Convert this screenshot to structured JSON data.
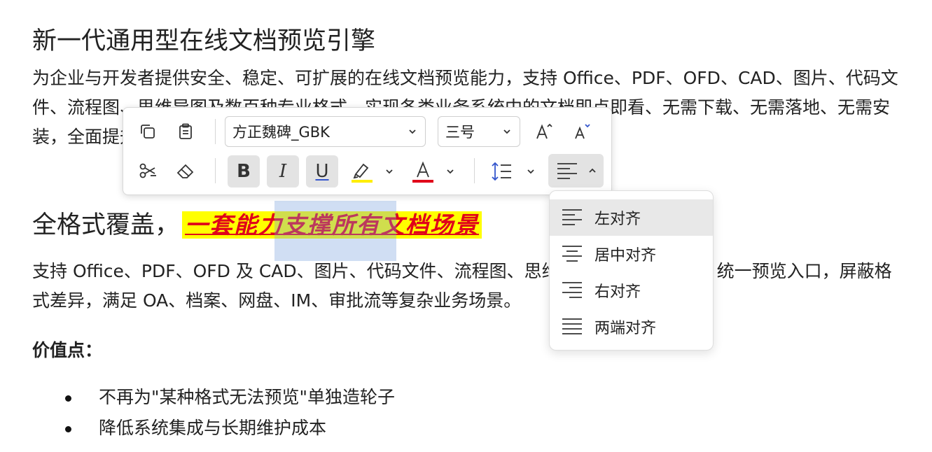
{
  "document": {
    "title": "新一代通用型在线文档预览引擎",
    "para1": "为企业与开发者提供安全、稳定、可扩展的在线文档预览能力，支持 Office、PDF、OFD、CAD、图片、代码文件、流程图、思维导图及数百种专业格式，实现各类业务系统中的文档即点即看、无需下载、无需落地、无需安装，全面提升效率与安全性，为数字化系统的文档预览基础设施。",
    "heading2_prefix": "全格式覆盖，",
    "heading2_styled": "一套能力支撑所有文档场景",
    "para2": "支持 Office、PDF、OFD 及 CAD、图片、代码文件、流程图、思维导图等数百种格式，统一预览入口，屏蔽格式差异，满足 OA、档案、网盘、IM、审批流等复杂业务场景。",
    "value_label": "价值点：",
    "bullets": [
      "不再为\"某种格式无法预览\"单独造轮子",
      "降低系统集成与长期维护成本"
    ]
  },
  "toolbar": {
    "font_family": "方正魏碑_GBK",
    "font_size": "三号",
    "highlight_color": "#ffee00",
    "font_color": "#e0001a",
    "active_buttons": [
      "bold",
      "italic",
      "underline",
      "align"
    ]
  },
  "align_menu": {
    "items": [
      "左对齐",
      "居中对齐",
      "右对齐",
      "两端对齐"
    ],
    "hovered": "左对齐"
  },
  "colors": {
    "text_highlight": "#ffff00",
    "styled_text": "#e0001a",
    "selection": "#a9c1e8"
  }
}
